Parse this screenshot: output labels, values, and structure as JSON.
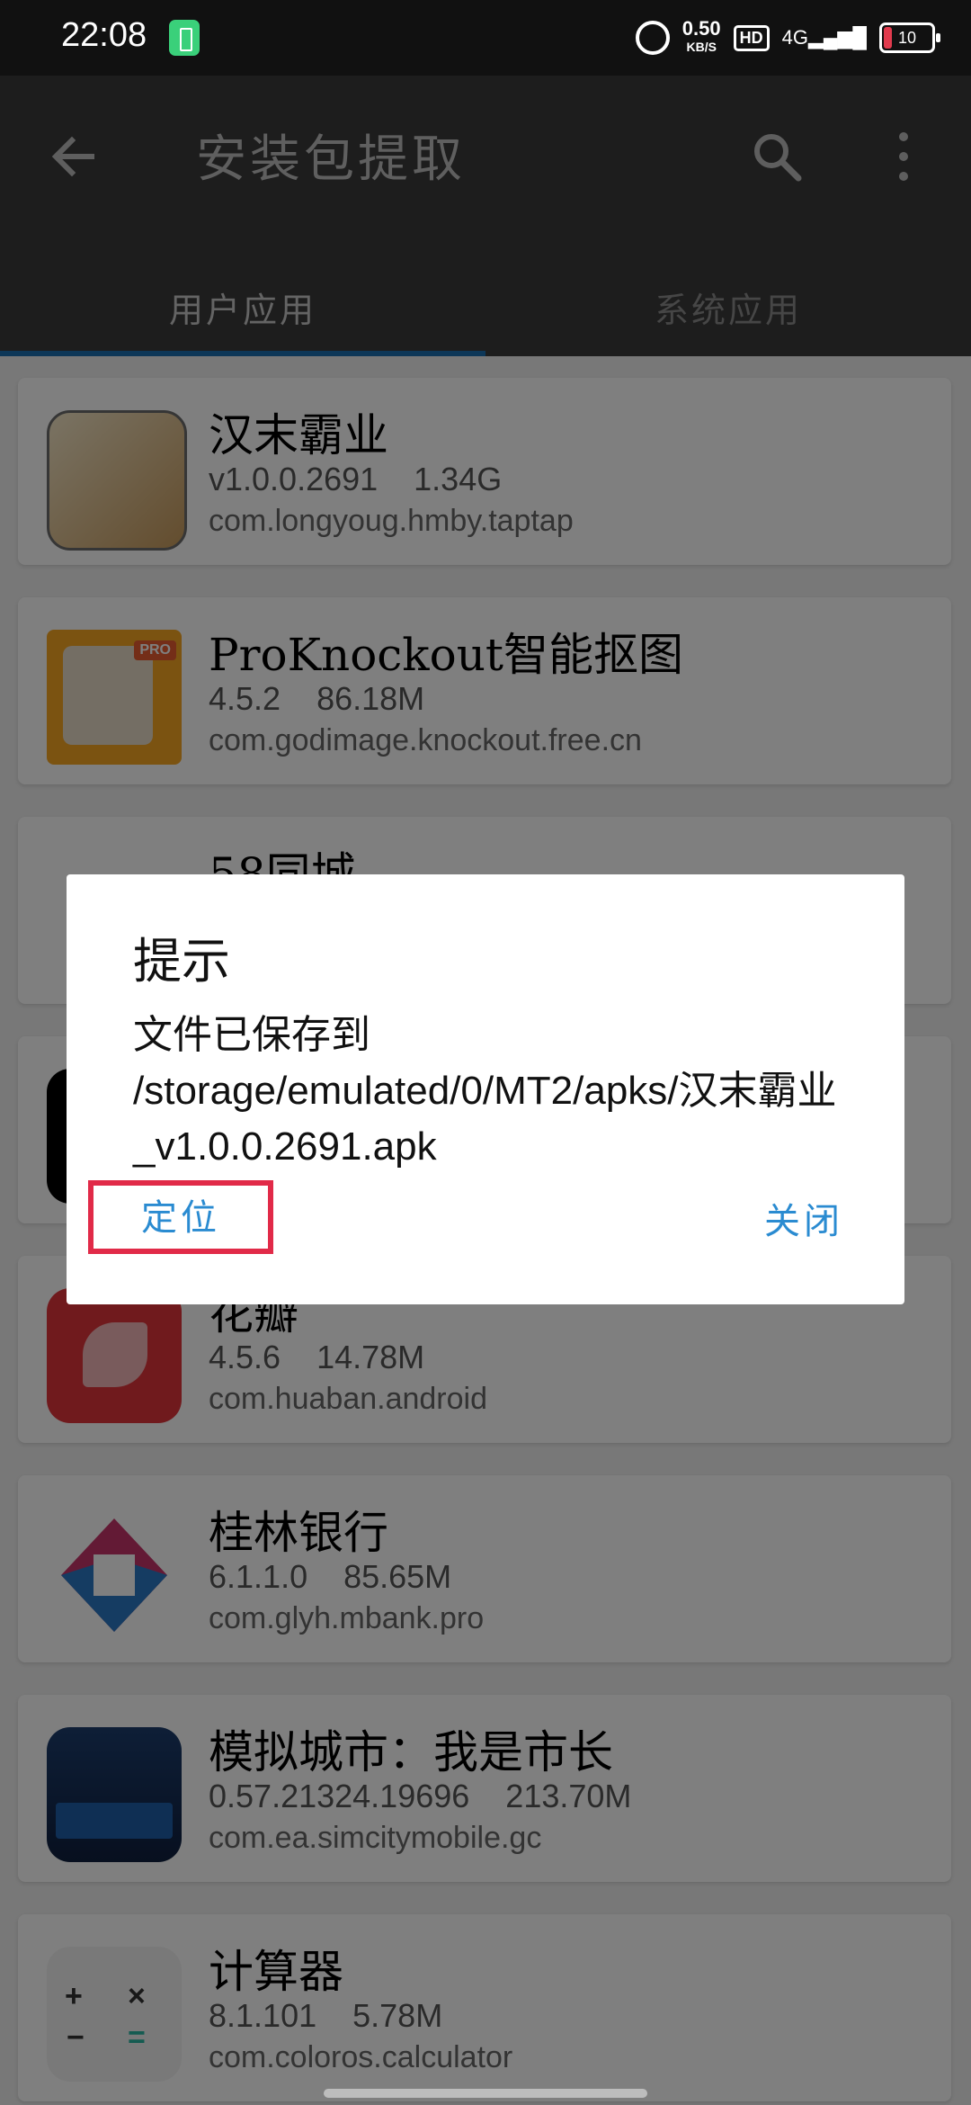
{
  "status_bar": {
    "time": "22:08",
    "speed_value": "0.50",
    "speed_unit": "KB/S",
    "hd": "HD",
    "network": "4G",
    "battery": "10"
  },
  "app_bar": {
    "title": "安装包提取",
    "tabs": [
      "用户应用",
      "系统应用"
    ]
  },
  "apps": [
    {
      "name": "汉末霸业",
      "version": "v1.0.0.2691",
      "size": "1.34G",
      "package": "com.longyoug.hmby.taptap"
    },
    {
      "name": "ProKnockout智能抠图",
      "version": "4.5.2",
      "size": "86.18M",
      "package": "com.godimage.knockout.free.cn"
    },
    {
      "name": "58同城",
      "version": "",
      "size": "",
      "package": ""
    },
    {
      "name": "",
      "version": "",
      "size": "",
      "package": ""
    },
    {
      "name": "花瓣",
      "version": "4.5.6",
      "size": "14.78M",
      "package": "com.huaban.android"
    },
    {
      "name": "桂林银行",
      "version": "6.1.1.0",
      "size": "85.65M",
      "package": "com.glyh.mbank.pro"
    },
    {
      "name": "模拟城市：我是市长",
      "version": "0.57.21324.19696",
      "size": "213.70M",
      "package": "com.ea.simcitymobile.gc"
    },
    {
      "name": "计算器",
      "version": "8.1.101",
      "size": "5.78M",
      "package": "com.coloros.calculator"
    }
  ],
  "dialog": {
    "title": "提示",
    "message": "文件已保存到 /storage/emulated/0/MT2/apks/汉末霸业_v1.0.0.2691.apk",
    "locate_label": "定位",
    "close_label": "关闭"
  },
  "icons": {
    "back": "arrow-left-icon",
    "search": "search-icon",
    "more": "more-vert-icon"
  },
  "colors": {
    "accent": "#2a8bd1",
    "tab_indicator": "#1b6fb0",
    "highlight_border": "#e12a48"
  }
}
